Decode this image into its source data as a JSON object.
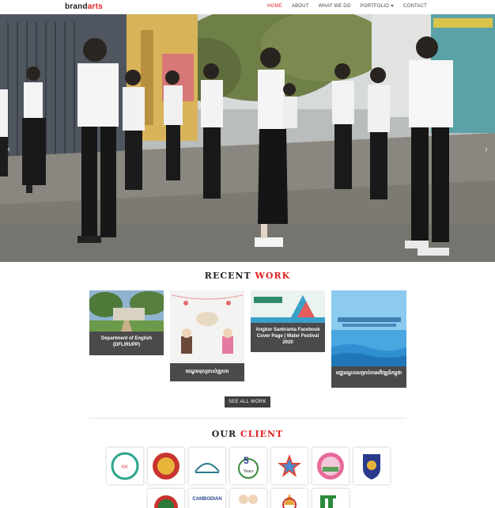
{
  "brand": {
    "part1": "brand",
    "part2": "arts"
  },
  "nav": {
    "items": [
      {
        "label": "HOME",
        "active": true
      },
      {
        "label": "ABOUT",
        "active": false
      },
      {
        "label": "WHAT WE DO",
        "active": false
      },
      {
        "label": "PORTFOLIO",
        "active": false,
        "dropdown": true
      },
      {
        "label": "CONTACT",
        "active": false
      }
    ]
  },
  "hero": {
    "prev_icon": "chevron-left-icon",
    "next_icon": "chevron-right-icon"
  },
  "recent_work": {
    "title_part1": "RECENT",
    "title_part2": "WORK",
    "cards": [
      {
        "caption": "Department of English (DFL/RUPP)"
      },
      {
        "caption": "មេណ្ឌមនុស្សចាស់គ្រួសារ"
      },
      {
        "caption": "Angkor Sankranta Facebook Cover Page | Water Festival 2020"
      },
      {
        "caption": "មជ្ឈមណ្ឌលសម្រាប់ការអភិវឌ្ឍន៍កម្ពុជា"
      }
    ],
    "see_all_label": "SEE ALL WORK"
  },
  "clients": {
    "title_part1": "OUR",
    "title_part2": "CLIENT",
    "logos_row1": [
      "client-logo-1",
      "client-logo-2",
      "client-logo-3",
      "client-logo-4",
      "client-logo-5",
      "client-logo-6",
      "client-logo-7"
    ],
    "logo_texts": {
      "five_years": "5",
      "five_years_sub": "Years",
      "cambodian": "CAMBODIAN"
    }
  },
  "colors": {
    "accent": "#e02020",
    "card_bg": "#4a4a4a"
  }
}
